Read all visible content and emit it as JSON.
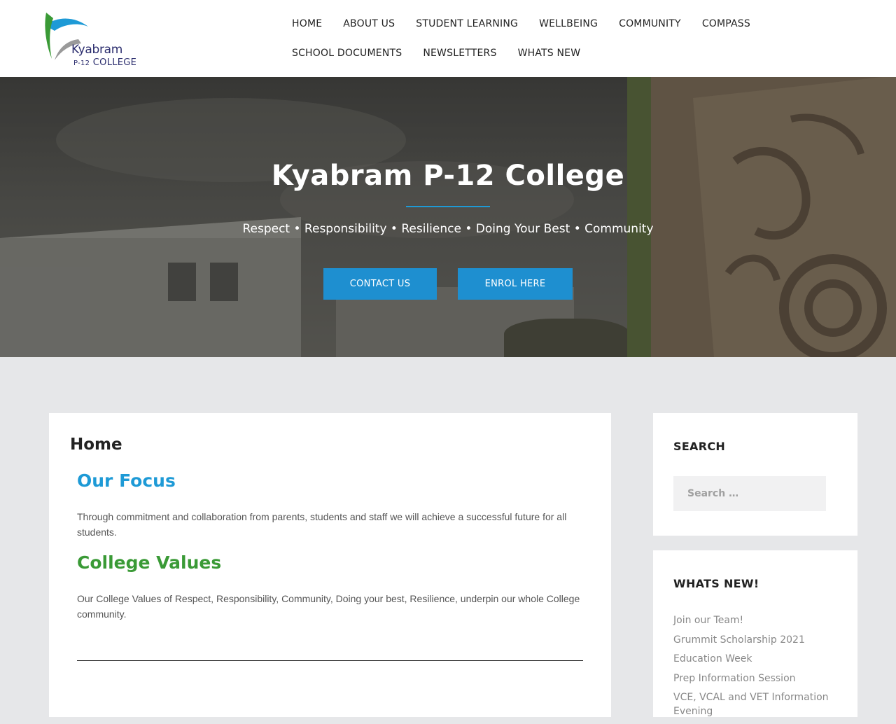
{
  "header": {
    "logo": {
      "name": "Kyabram",
      "sub_small": "P-12",
      "sub": "COLLEGE",
      "colors": {
        "blue": "#1e9ad6",
        "green": "#3a9a36",
        "grey": "#9a9a9a",
        "navy": "#2b2d6e"
      }
    },
    "nav": [
      {
        "label": "HOME"
      },
      {
        "label": "ABOUT US"
      },
      {
        "label": "STUDENT LEARNING"
      },
      {
        "label": "WELLBEING"
      },
      {
        "label": "COMMUNITY"
      },
      {
        "label": "COMPASS"
      },
      {
        "label": "SCHOOL DOCUMENTS"
      },
      {
        "label": "NEWSLETTERS"
      },
      {
        "label": "WHATS NEW"
      }
    ]
  },
  "hero": {
    "title": "Kyabram P-12 College",
    "tagline": "Respect • Responsibility • Resilience • Doing Your Best • Community",
    "buttons": {
      "contact": "CONTACT US",
      "enrol": "ENROL HERE"
    },
    "accent_color": "#1e8fd0"
  },
  "main": {
    "page_title": "Home",
    "focus": {
      "heading": "Our Focus",
      "text": "Through commitment and collaboration from parents, students and staff we will achieve a successful future for all students."
    },
    "values": {
      "heading": "College Values",
      "text": "Our College Values of Respect, Responsibility, Community, Doing your best, Resilience, underpin our whole College community."
    }
  },
  "sidebar": {
    "search": {
      "title": "SEARCH",
      "placeholder": "Search …"
    },
    "news": {
      "title": "WHATS NEW!",
      "items": [
        {
          "label": "Join our Team!"
        },
        {
          "label": "Grummit Scholarship 2021"
        },
        {
          "label": "Education Week"
        },
        {
          "label": "Prep Information Session"
        },
        {
          "label": "VCE, VCAL and VET Information Evening"
        }
      ]
    }
  }
}
